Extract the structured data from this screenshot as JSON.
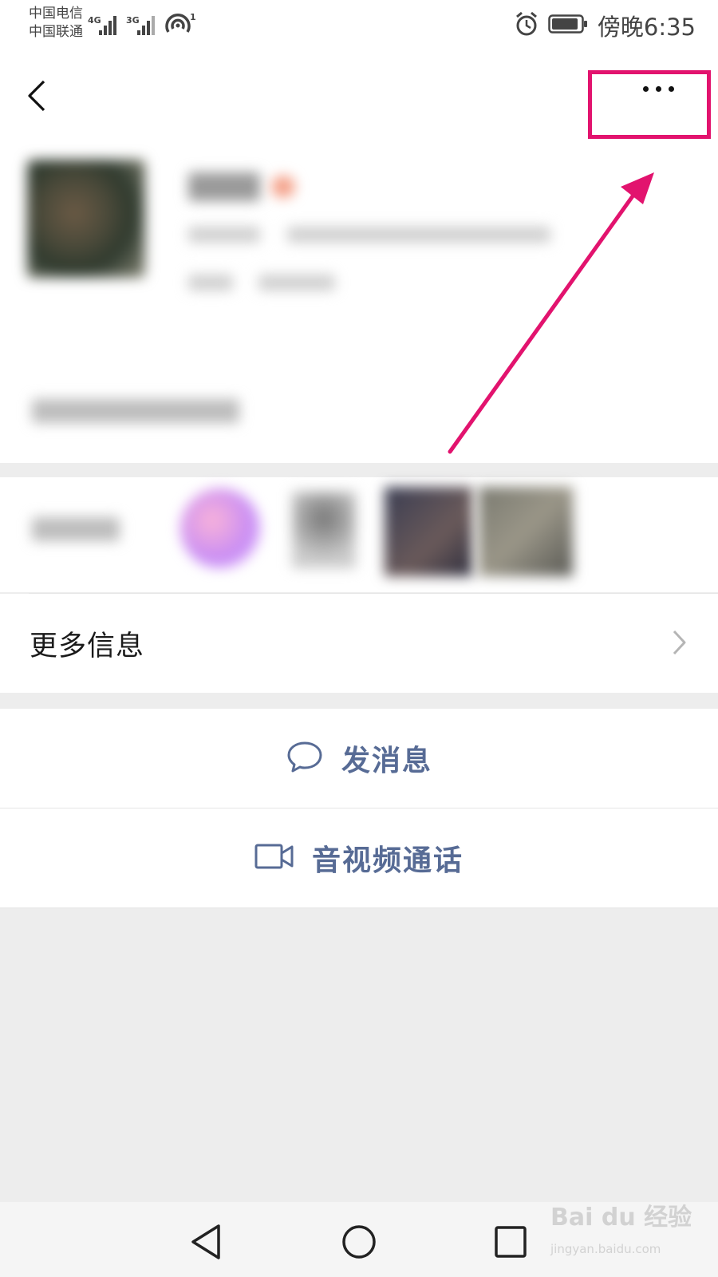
{
  "status_bar": {
    "carrier_1": "中国电信",
    "carrier_2": "中国联通",
    "net_1": "4G",
    "net_2": "3G",
    "hotspot_count": "1",
    "time": "傍晚6:35"
  },
  "profile": {
    "name": "",
    "detail": ""
  },
  "more_info": {
    "label": "更多信息"
  },
  "actions": {
    "message_label": "发消息",
    "call_label": "音视频通话"
  },
  "watermark": {
    "brand": "Bai du 经验",
    "url": "jingyan.baidu.com"
  },
  "colors": {
    "link_blue": "#576b95",
    "annotation_pink": "#e2136e",
    "background_gray": "#ededed"
  }
}
